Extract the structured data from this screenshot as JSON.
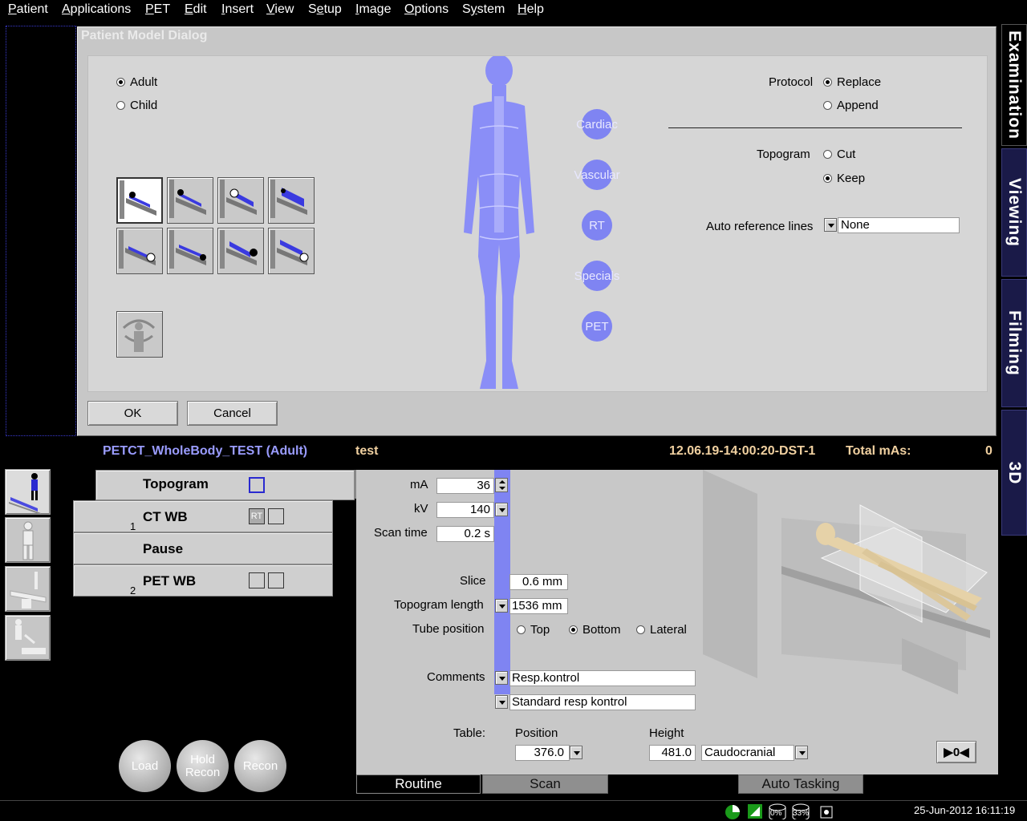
{
  "menu": [
    "Patient",
    "Applications",
    "PET",
    "Edit",
    "Insert",
    "View",
    "Setup",
    "Image",
    "Options",
    "System",
    "Help"
  ],
  "menu_mnemonic_index": [
    0,
    0,
    0,
    0,
    0,
    0,
    1,
    0,
    0,
    1,
    0
  ],
  "right_tabs": [
    "Examination",
    "Viewing",
    "Filming",
    "3D"
  ],
  "dialog": {
    "title": "Patient Model Dialog",
    "age_options": [
      {
        "label": "Adult",
        "selected": true
      },
      {
        "label": "Child",
        "selected": false
      }
    ],
    "regions": [
      "Cardiac",
      "Vascular",
      "RT",
      "Specials",
      "PET"
    ],
    "protocol_label": "Protocol",
    "protocol_options": [
      {
        "label": "Replace",
        "selected": true
      },
      {
        "label": "Append",
        "selected": false
      }
    ],
    "topogram_label": "Topogram",
    "topogram_options": [
      {
        "label": "Cut",
        "selected": false
      },
      {
        "label": "Keep",
        "selected": true
      }
    ],
    "auto_ref_label": "Auto reference lines",
    "auto_ref_value": "None",
    "ok": "OK",
    "cancel": "Cancel"
  },
  "info": {
    "protocol_name": "PETCT_WholeBody_TEST (Adult)",
    "patient": "test",
    "exam_id": "12.06.19-14:00:20-DST-1",
    "total_mas_label": "Total mAs:",
    "total_mas_value": "0"
  },
  "scan_list": [
    {
      "name": "Topogram",
      "number": ""
    },
    {
      "name": "CT WB",
      "number": "1",
      "rt": "RT"
    },
    {
      "name": "Pause",
      "number": ""
    },
    {
      "name": "PET WB",
      "number": "2"
    }
  ],
  "round_buttons": [
    "Load",
    "Hold Recon",
    "Recon"
  ],
  "params": {
    "ma_label": "mA",
    "ma_value": "36",
    "kv_label": "kV",
    "kv_value": "140",
    "scantime_label": "Scan time",
    "scantime_value": "0.2 s",
    "slice_label": "Slice",
    "slice_value": "0.6 mm",
    "topolength_label": "Topogram length",
    "topolength_value": "1536 mm",
    "tubepos_label": "Tube position",
    "tubepos_options": [
      {
        "label": "Top",
        "selected": false
      },
      {
        "label": "Bottom",
        "selected": true
      },
      {
        "label": "Lateral",
        "selected": false
      }
    ],
    "comments_label": "Comments",
    "comment1": "Resp.kontrol",
    "comment2": "Standard resp kontrol",
    "table_label": "Table:",
    "position_label": "Position",
    "position_value": "376.0",
    "height_label": "Height",
    "height_value": "481.0",
    "direction_value": "Caudocranial",
    "goto_button": "▶0◀"
  },
  "bottom_tabs": [
    "Routine",
    "Scan",
    "Auto Tasking"
  ],
  "status": {
    "disk1": "0%",
    "disk2": "33%",
    "datetime": "25-Jun-2012 16:11:19"
  },
  "colors": {
    "accent": "#7f84f2",
    "tab_bg": "#1a1a48",
    "info_blue": "#9a9cff",
    "info_tan": "#f0d0a0"
  }
}
